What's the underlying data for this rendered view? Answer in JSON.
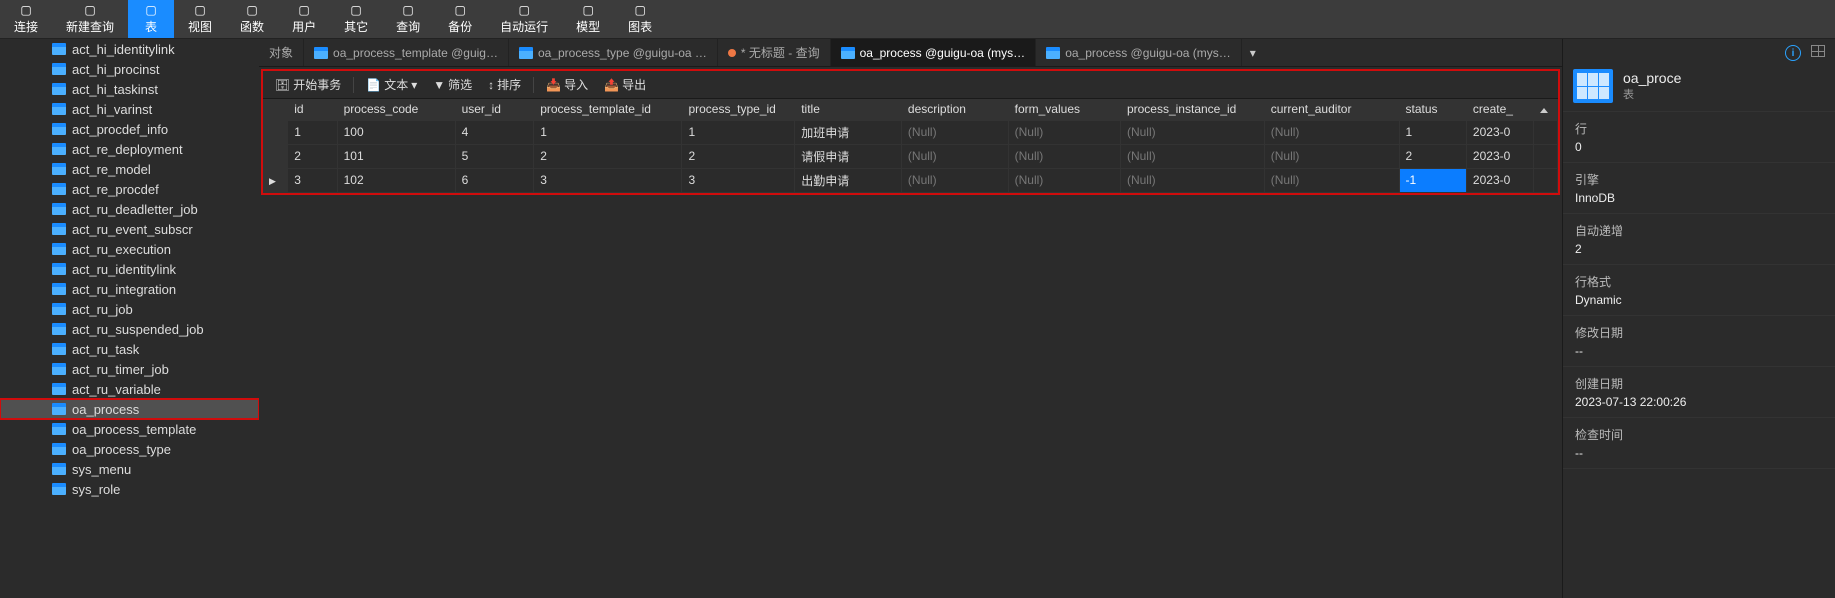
{
  "topbar": [
    {
      "label": "连接",
      "active": false
    },
    {
      "label": "新建查询",
      "active": false
    },
    {
      "label": "表",
      "active": true
    },
    {
      "label": "视图",
      "active": false
    },
    {
      "label": "函数",
      "active": false
    },
    {
      "label": "用户",
      "active": false
    },
    {
      "label": "其它",
      "active": false
    },
    {
      "label": "查询",
      "active": false
    },
    {
      "label": "备份",
      "active": false
    },
    {
      "label": "自动运行",
      "active": false
    },
    {
      "label": "模型",
      "active": false
    },
    {
      "label": "图表",
      "active": false
    }
  ],
  "tree": [
    {
      "label": "act_hi_identitylink"
    },
    {
      "label": "act_hi_procinst"
    },
    {
      "label": "act_hi_taskinst"
    },
    {
      "label": "act_hi_varinst"
    },
    {
      "label": "act_procdef_info"
    },
    {
      "label": "act_re_deployment"
    },
    {
      "label": "act_re_model"
    },
    {
      "label": "act_re_procdef"
    },
    {
      "label": "act_ru_deadletter_job"
    },
    {
      "label": "act_ru_event_subscr"
    },
    {
      "label": "act_ru_execution"
    },
    {
      "label": "act_ru_identitylink"
    },
    {
      "label": "act_ru_integration"
    },
    {
      "label": "act_ru_job"
    },
    {
      "label": "act_ru_suspended_job"
    },
    {
      "label": "act_ru_task"
    },
    {
      "label": "act_ru_timer_job"
    },
    {
      "label": "act_ru_variable"
    },
    {
      "label": "oa_process",
      "selected": true,
      "highlight": true
    },
    {
      "label": "oa_process_template"
    },
    {
      "label": "oa_process_type"
    },
    {
      "label": "sys_menu"
    },
    {
      "label": "sys_role"
    }
  ],
  "tabs": [
    {
      "label": "对象",
      "active": false,
      "icon": "none"
    },
    {
      "label": "oa_process_template @guig…",
      "active": false,
      "icon": "table"
    },
    {
      "label": "oa_process_type @guigu-oa …",
      "active": false,
      "icon": "table"
    },
    {
      "label": "* 无标题 - 查询",
      "active": false,
      "icon": "dot"
    },
    {
      "label": "oa_process @guigu-oa (mys…",
      "active": true,
      "icon": "table"
    },
    {
      "label": "oa_process @guigu-oa (mys…",
      "active": false,
      "icon": "table"
    }
  ],
  "innerTb": {
    "begin": "开始事务",
    "text": "文本",
    "filter": "筛选",
    "sort": "排序",
    "import": "导入",
    "export": "导出"
  },
  "columns": [
    "id",
    "process_code",
    "user_id",
    "process_template_id",
    "process_type_id",
    "title",
    "description",
    "form_values",
    "process_instance_id",
    "current_auditor",
    "status",
    "create_"
  ],
  "rows": [
    {
      "cur": false,
      "id": "1",
      "process_code": "100",
      "user_id": "4",
      "process_template_id": "1",
      "process_type_id": "1",
      "title": "加班申请",
      "description": "(Null)",
      "form_values": "(Null)",
      "process_instance_id": "(Null)",
      "current_auditor": "(Null)",
      "status": "1",
      "create_": "2023-0"
    },
    {
      "cur": false,
      "id": "2",
      "process_code": "101",
      "user_id": "5",
      "process_template_id": "2",
      "process_type_id": "2",
      "title": "请假申请",
      "description": "(Null)",
      "form_values": "(Null)",
      "process_instance_id": "(Null)",
      "current_auditor": "(Null)",
      "status": "2",
      "create_": "2023-0"
    },
    {
      "cur": true,
      "id": "3",
      "process_code": "102",
      "user_id": "6",
      "process_template_id": "3",
      "process_type_id": "3",
      "title": "出勤申请",
      "description": "(Null)",
      "form_values": "(Null)",
      "process_instance_id": "(Null)",
      "current_auditor": "(Null)",
      "status": "-1",
      "create_": "2023-0",
      "statusSel": true
    }
  ],
  "props": {
    "title": "oa_proce",
    "sub": "表",
    "blocks": [
      {
        "label": "行",
        "value": "0"
      },
      {
        "label": "引擎",
        "value": "InnoDB"
      },
      {
        "label": "自动递增",
        "value": "2"
      },
      {
        "label": "行格式",
        "value": "Dynamic"
      },
      {
        "label": "修改日期",
        "value": "--"
      },
      {
        "label": "创建日期",
        "value": "2023-07-13 22:00:26"
      },
      {
        "label": "检查时间",
        "value": "--"
      }
    ]
  }
}
